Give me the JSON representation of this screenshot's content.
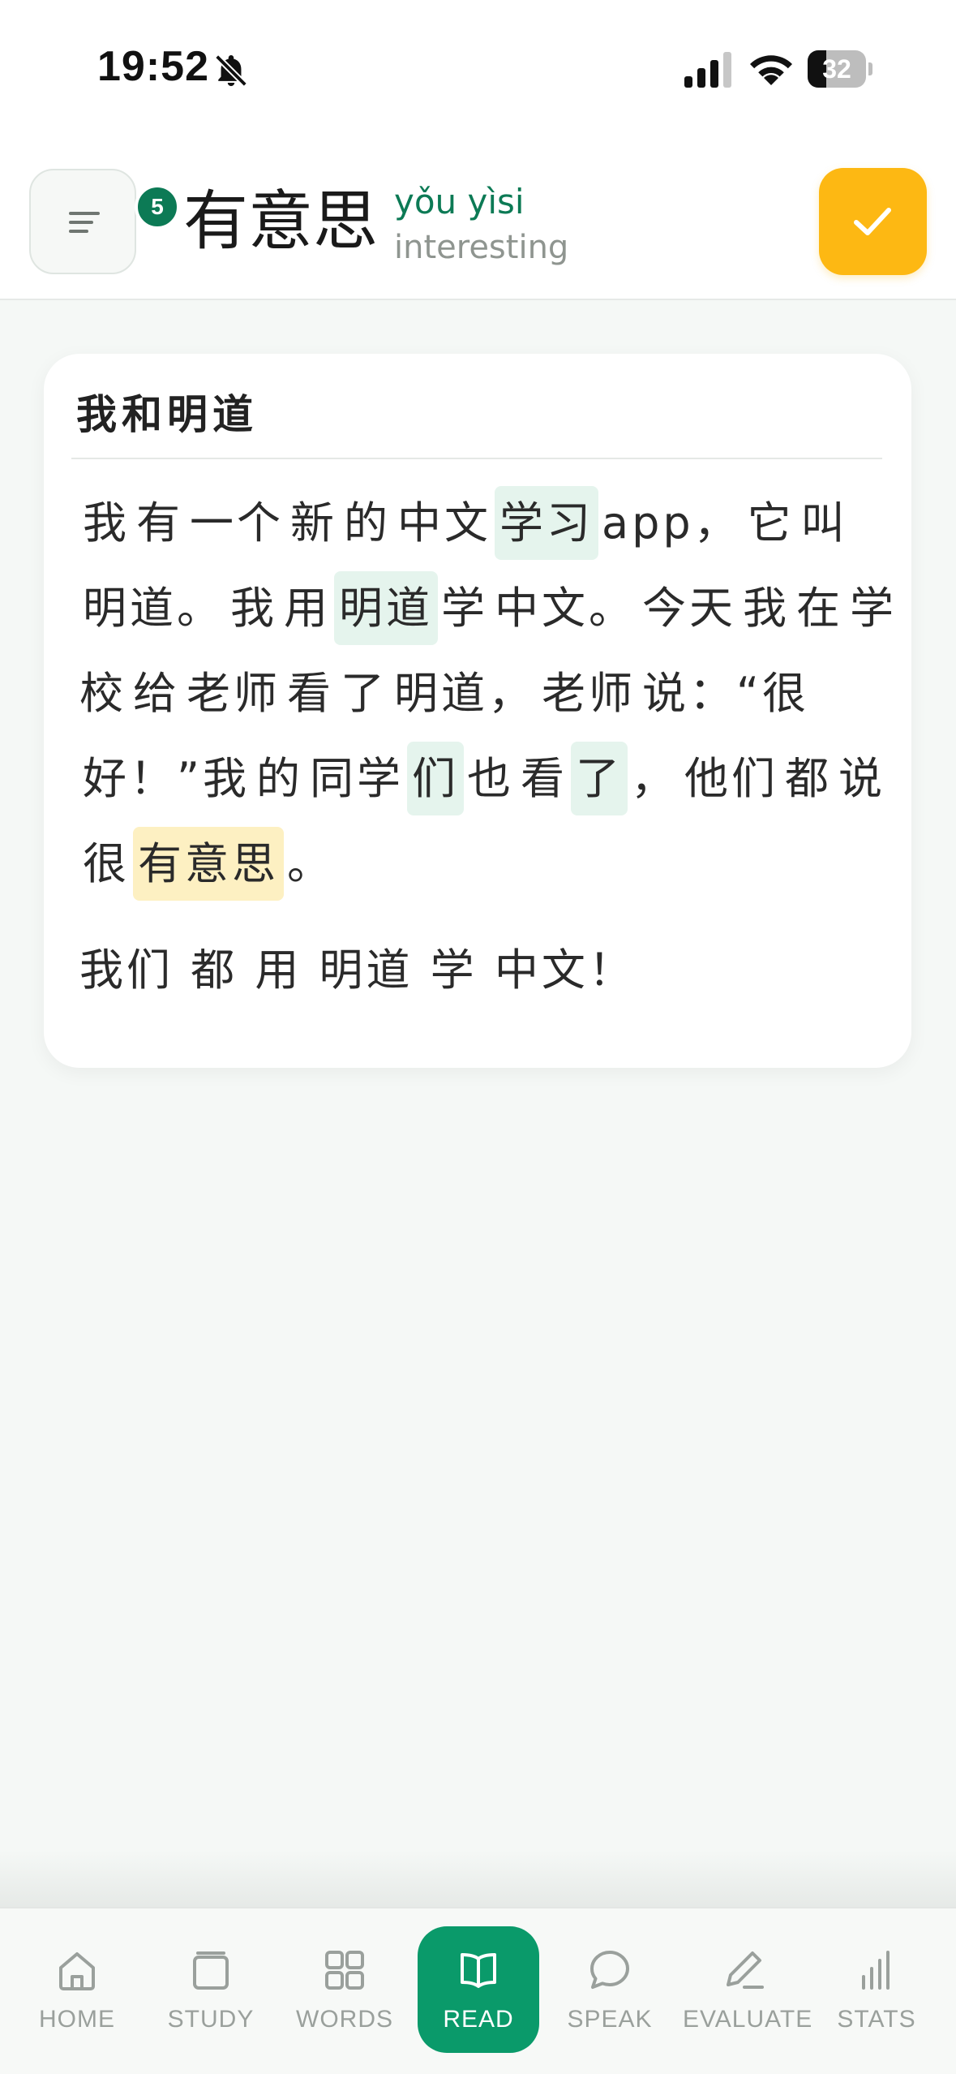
{
  "status_bar": {
    "time": "19:52",
    "battery_level": "32"
  },
  "header": {
    "menu_badge_count": "5",
    "word": {
      "hanzi": "有意思",
      "pinyin": "yǒu yìsi",
      "meaning": "interesting"
    }
  },
  "reading": {
    "title": "我和明道",
    "paragraph1": [
      {
        "t": "我",
        "style": "plain"
      },
      {
        "t": "有",
        "style": "plain"
      },
      {
        "t": "一个",
        "style": "plain"
      },
      {
        "t": "新",
        "style": "plain"
      },
      {
        "t": "的",
        "style": "plain"
      },
      {
        "t": "中文",
        "style": "plain"
      },
      {
        "t": "学习",
        "style": "highlight"
      },
      {
        "t": "app，",
        "style": "plain"
      },
      {
        "t": "它",
        "style": "plain"
      },
      {
        "t": "叫",
        "style": "plain"
      },
      {
        "t": "明道。",
        "style": "plain"
      },
      {
        "t": "我",
        "style": "plain"
      },
      {
        "t": "用",
        "style": "plain"
      },
      {
        "t": "明道",
        "style": "highlight"
      },
      {
        "t": "学",
        "style": "plain"
      },
      {
        "t": "中文。",
        "style": "plain"
      },
      {
        "t": "今天",
        "style": "plain"
      },
      {
        "t": "我",
        "style": "plain"
      },
      {
        "t": "在",
        "style": "plain"
      },
      {
        "t": "学校",
        "style": "plain"
      },
      {
        "t": "给",
        "style": "plain"
      },
      {
        "t": "老师",
        "style": "plain"
      },
      {
        "t": "看",
        "style": "plain"
      },
      {
        "t": "了",
        "style": "plain"
      },
      {
        "t": "明道，",
        "style": "plain"
      },
      {
        "t": "老师",
        "style": "plain"
      },
      {
        "t": "说：“很",
        "style": "plain"
      },
      {
        "t": "好！”我",
        "style": "plain"
      },
      {
        "t": "的",
        "style": "plain"
      },
      {
        "t": "同学",
        "style": "plain"
      },
      {
        "t": "们",
        "style": "highlight"
      },
      {
        "t": "也",
        "style": "plain"
      },
      {
        "t": "看",
        "style": "plain"
      },
      {
        "t": "了",
        "style": "highlight"
      },
      {
        "t": "，",
        "style": "plain"
      },
      {
        "t": "他们",
        "style": "plain"
      },
      {
        "t": "都",
        "style": "plain"
      },
      {
        "t": "说",
        "style": "plain"
      },
      {
        "t": "很",
        "style": "plain"
      },
      {
        "t": "有意思",
        "style": "active"
      },
      {
        "t": "。",
        "style": "plain"
      }
    ],
    "paragraph2": "我们 都 用 明道 学 中文！"
  },
  "nav": {
    "items": [
      {
        "key": "home",
        "label": "HOME"
      },
      {
        "key": "study",
        "label": "STUDY"
      },
      {
        "key": "words",
        "label": "WORDS"
      },
      {
        "key": "read",
        "label": "READ"
      },
      {
        "key": "speak",
        "label": "SPEAK"
      },
      {
        "key": "evaluate",
        "label": "EVALUATE"
      },
      {
        "key": "stats",
        "label": "STATS"
      }
    ],
    "active": "read"
  },
  "colors": {
    "brand_green": "#0a9a6a",
    "badge_green": "#0c7a55",
    "accent_yellow": "#fdb813",
    "highlight_known": "#e5f4ed",
    "highlight_current": "#fdf0c2"
  },
  "icons": {
    "status": [
      "bell-slash-icon",
      "cellular-signal-icon",
      "wifi-icon",
      "battery-icon"
    ],
    "header": [
      "menu-lines-icon",
      "checkmark-icon"
    ],
    "nav": [
      "house-icon",
      "flashcards-icon",
      "grid-icon",
      "open-book-icon",
      "speech-bubble-icon",
      "pencil-icon",
      "bar-chart-icon"
    ]
  }
}
